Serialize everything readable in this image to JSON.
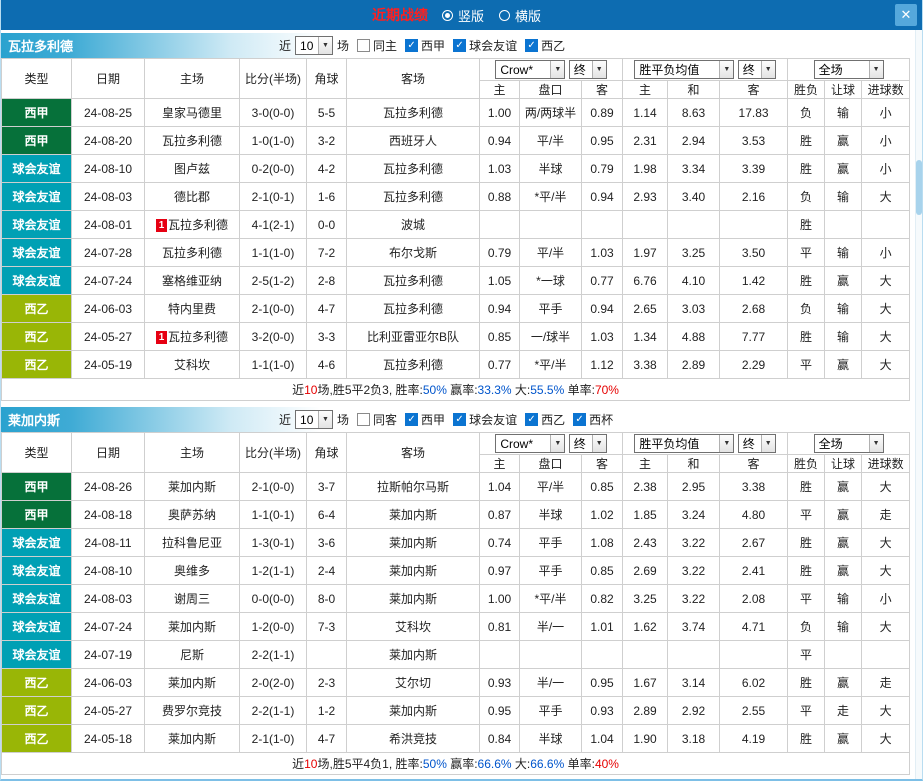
{
  "top_bar": {
    "title": "近期战绩",
    "portrait_label": "竖版",
    "landscape_label": "横版",
    "close_label": "✕"
  },
  "labels": {
    "near": "近",
    "games": "场"
  },
  "controls": {
    "odds_source": "Crow*",
    "final": "终",
    "europe_avg": "胜平负均值",
    "scope": "全场"
  },
  "columns": {
    "left": [
      "类型",
      "日期",
      "主场",
      "比分(半场)",
      "角球",
      "客场"
    ],
    "sub": [
      "主",
      "盘口",
      "客",
      "主",
      "和",
      "客",
      "胜负",
      "让球",
      "进球数"
    ]
  },
  "type_colors": {
    "西甲": "#06713a",
    "球会友谊": "#00a0b4",
    "西乙": "#99b606"
  },
  "sections": [
    {
      "team": "瓦拉多利德",
      "count": "10",
      "checkboxes": [
        {
          "label": "同主",
          "checked": false
        },
        {
          "label": "西甲",
          "checked": true
        },
        {
          "label": "球会友谊",
          "checked": true
        },
        {
          "label": "西乙",
          "checked": true
        }
      ],
      "rows": [
        {
          "type": "西甲",
          "date": "24-08-25",
          "home": "皇家马德里",
          "home_team": false,
          "home_badge": false,
          "score": "3-0(0-0)",
          "corners": "5-5",
          "away": "瓦拉多利德",
          "away_team": true,
          "ah_home": "1.00",
          "handicap": "两/两球半",
          "handicap_red": false,
          "ah_away": "0.89",
          "eu_home": "1.14",
          "eu_draw": "8.63",
          "eu_away": "17.83",
          "result": "负",
          "result_c": "r",
          "cover": "输",
          "cover_c": "g",
          "goals": "小",
          "goals_c": "g"
        },
        {
          "type": "西甲",
          "date": "24-08-20",
          "home": "瓦拉多利德",
          "home_team": true,
          "home_badge": false,
          "score": "1-0(1-0)",
          "corners": "3-2",
          "away": "西班牙人",
          "away_team": false,
          "ah_home": "0.94",
          "handicap": "平/半",
          "handicap_red": false,
          "ah_away": "0.95",
          "eu_home": "2.31",
          "eu_draw": "2.94",
          "eu_away": "3.53",
          "result": "胜",
          "result_c": "r",
          "cover": "赢",
          "cover_c": "r",
          "goals": "小",
          "goals_c": "g"
        },
        {
          "type": "球会友谊",
          "date": "24-08-10",
          "home": "图卢兹",
          "home_team": false,
          "home_badge": false,
          "score": "0-2(0-0)",
          "corners": "4-2",
          "away": "瓦拉多利德",
          "away_team": true,
          "ah_home": "1.03",
          "handicap": "半球",
          "handicap_red": false,
          "ah_away": "0.79",
          "eu_home": "1.98",
          "eu_draw": "3.34",
          "eu_away": "3.39",
          "result": "胜",
          "result_c": "r",
          "cover": "赢",
          "cover_c": "r",
          "goals": "小",
          "goals_c": "g"
        },
        {
          "type": "球会友谊",
          "date": "24-08-03",
          "home": "德比郡",
          "home_team": false,
          "home_badge": false,
          "score": "2-1(0-1)",
          "corners": "1-6",
          "away": "瓦拉多利德",
          "away_team": true,
          "ah_home": "0.88",
          "handicap": "*平/半",
          "handicap_red": true,
          "ah_away": "0.94",
          "eu_home": "2.93",
          "eu_draw": "3.40",
          "eu_away": "2.16",
          "result": "负",
          "result_c": "r",
          "cover": "输",
          "cover_c": "g",
          "goals": "大",
          "goals_c": "r"
        },
        {
          "type": "球会友谊",
          "date": "24-08-01",
          "home": "瓦拉多利德",
          "home_team": true,
          "home_badge": true,
          "score": "4-1(2-1)",
          "corners": "0-0",
          "away": "波城",
          "away_team": false,
          "ah_home": "",
          "handicap": "",
          "handicap_red": false,
          "ah_away": "",
          "eu_home": "",
          "eu_draw": "",
          "eu_away": "",
          "result": "胜",
          "result_c": "r",
          "cover": "",
          "cover_c": "k",
          "goals": "",
          "goals_c": "k"
        },
        {
          "type": "球会友谊",
          "date": "24-07-28",
          "home": "瓦拉多利德",
          "home_team": true,
          "home_badge": false,
          "score": "1-1(1-0)",
          "corners": "7-2",
          "away": "布尔戈斯",
          "away_team": false,
          "ah_home": "0.79",
          "handicap": "平/半",
          "handicap_red": false,
          "ah_away": "1.03",
          "eu_home": "1.97",
          "eu_draw": "3.25",
          "eu_away": "3.50",
          "result": "平",
          "result_c": "k",
          "cover": "输",
          "cover_c": "g",
          "goals": "小",
          "goals_c": "g"
        },
        {
          "type": "球会友谊",
          "date": "24-07-24",
          "home": "塞格维亚纳",
          "home_team": false,
          "home_badge": false,
          "score": "2-5(1-2)",
          "corners": "2-8",
          "away": "瓦拉多利德",
          "away_team": true,
          "ah_home": "1.05",
          "handicap": "*一球",
          "handicap_red": true,
          "ah_away": "0.77",
          "eu_home": "6.76",
          "eu_draw": "4.10",
          "eu_away": "1.42",
          "result": "胜",
          "result_c": "r",
          "cover": "赢",
          "cover_c": "r",
          "goals": "大",
          "goals_c": "r"
        },
        {
          "type": "西乙",
          "date": "24-06-03",
          "home": "特内里费",
          "home_team": false,
          "home_badge": false,
          "score": "2-1(0-0)",
          "corners": "4-7",
          "away": "瓦拉多利德",
          "away_team": true,
          "ah_home": "0.94",
          "handicap": "平手",
          "handicap_red": false,
          "ah_away": "0.94",
          "eu_home": "2.65",
          "eu_draw": "3.03",
          "eu_away": "2.68",
          "result": "负",
          "result_c": "r",
          "cover": "输",
          "cover_c": "g",
          "goals": "大",
          "goals_c": "r"
        },
        {
          "type": "西乙",
          "date": "24-05-27",
          "home": "瓦拉多利德",
          "home_team": true,
          "home_badge": true,
          "score": "3-2(0-0)",
          "corners": "3-3",
          "away": "比利亚雷亚尔B队",
          "away_team": false,
          "ah_home": "0.85",
          "handicap": "一/球半",
          "handicap_red": true,
          "ah_away": "1.03",
          "eu_home": "1.34",
          "eu_draw": "4.88",
          "eu_away": "7.77",
          "result": "胜",
          "result_c": "r",
          "cover": "输",
          "cover_c": "g",
          "goals": "大",
          "goals_c": "r"
        },
        {
          "type": "西乙",
          "date": "24-05-19",
          "home": "艾科坎",
          "home_team": false,
          "home_badge": false,
          "score": "1-1(1-0)",
          "corners": "4-6",
          "away": "瓦拉多利德",
          "away_team": true,
          "ah_home": "0.77",
          "handicap": "*平/半",
          "handicap_red": true,
          "ah_away": "1.12",
          "eu_home": "3.38",
          "eu_draw": "2.89",
          "eu_away": "2.29",
          "result": "平",
          "result_c": "k",
          "cover": "赢",
          "cover_c": "r",
          "goals": "大",
          "goals_c": "r"
        }
      ],
      "summary": [
        [
          "近",
          "k"
        ],
        [
          "10",
          "r"
        ],
        [
          "场,胜5平2负3, 胜率:",
          "k"
        ],
        [
          "50%",
          "b"
        ],
        [
          " 赢率:",
          "k"
        ],
        [
          "33.3%",
          "b"
        ],
        [
          " 大:",
          "k"
        ],
        [
          "55.5%",
          "b"
        ],
        [
          " 单率:",
          "k"
        ],
        [
          "70%",
          "r"
        ]
      ]
    },
    {
      "team": "莱加内斯",
      "count": "10",
      "checkboxes": [
        {
          "label": "同客",
          "checked": false
        },
        {
          "label": "西甲",
          "checked": true
        },
        {
          "label": "球会友谊",
          "checked": true
        },
        {
          "label": "西乙",
          "checked": true
        },
        {
          "label": "西杯",
          "checked": true
        }
      ],
      "rows": [
        {
          "type": "西甲",
          "date": "24-08-26",
          "home": "莱加内斯",
          "home_team": true,
          "home_badge": false,
          "score": "2-1(0-0)",
          "corners": "3-7",
          "away": "拉斯帕尔马斯",
          "away_team": false,
          "ah_home": "1.04",
          "handicap": "平/半",
          "handicap_red": false,
          "ah_away": "0.85",
          "eu_home": "2.38",
          "eu_draw": "2.95",
          "eu_away": "3.38",
          "result": "胜",
          "result_c": "r",
          "cover": "赢",
          "cover_c": "r",
          "goals": "大",
          "goals_c": "r"
        },
        {
          "type": "西甲",
          "date": "24-08-18",
          "home": "奥萨苏纳",
          "home_team": false,
          "home_badge": false,
          "score": "1-1(0-1)",
          "corners": "6-4",
          "away": "莱加内斯",
          "away_team": true,
          "ah_home": "0.87",
          "handicap": "半球",
          "handicap_red": false,
          "ah_away": "1.02",
          "eu_home": "1.85",
          "eu_draw": "3.24",
          "eu_away": "4.80",
          "result": "平",
          "result_c": "k",
          "cover": "赢",
          "cover_c": "r",
          "goals": "走",
          "goals_c": "r"
        },
        {
          "type": "球会友谊",
          "date": "24-08-11",
          "home": "拉科鲁尼亚",
          "home_team": false,
          "home_badge": false,
          "score": "1-3(0-1)",
          "corners": "3-6",
          "away": "莱加内斯",
          "away_team": true,
          "ah_home": "0.74",
          "handicap": "平手",
          "handicap_red": false,
          "ah_away": "1.08",
          "eu_home": "2.43",
          "eu_draw": "3.22",
          "eu_away": "2.67",
          "result": "胜",
          "result_c": "r",
          "cover": "赢",
          "cover_c": "r",
          "goals": "大",
          "goals_c": "r"
        },
        {
          "type": "球会友谊",
          "date": "24-08-10",
          "home": "奥维多",
          "home_team": false,
          "home_badge": false,
          "score": "1-2(1-1)",
          "corners": "2-4",
          "away": "莱加内斯",
          "away_team": true,
          "ah_home": "0.97",
          "handicap": "平手",
          "handicap_red": false,
          "ah_away": "0.85",
          "eu_home": "2.69",
          "eu_draw": "3.22",
          "eu_away": "2.41",
          "result": "胜",
          "result_c": "r",
          "cover": "赢",
          "cover_c": "r",
          "goals": "大",
          "goals_c": "r"
        },
        {
          "type": "球会友谊",
          "date": "24-08-03",
          "home": "谢周三",
          "home_team": false,
          "home_badge": false,
          "score": "0-0(0-0)",
          "corners": "8-0",
          "away": "莱加内斯",
          "away_team": true,
          "ah_home": "1.00",
          "handicap": "*平/半",
          "handicap_red": true,
          "ah_away": "0.82",
          "eu_home": "3.25",
          "eu_draw": "3.22",
          "eu_away": "2.08",
          "result": "平",
          "result_c": "k",
          "cover": "输",
          "cover_c": "g",
          "goals": "小",
          "goals_c": "g"
        },
        {
          "type": "球会友谊",
          "date": "24-07-24",
          "home": "莱加内斯",
          "home_team": true,
          "home_badge": false,
          "score": "1-2(0-0)",
          "corners": "7-3",
          "away": "艾科坎",
          "away_team": false,
          "ah_home": "0.81",
          "handicap": "半/一",
          "handicap_red": false,
          "ah_away": "1.01",
          "eu_home": "1.62",
          "eu_draw": "3.74",
          "eu_away": "4.71",
          "result": "负",
          "result_c": "r",
          "cover": "输",
          "cover_c": "g",
          "goals": "大",
          "goals_c": "r"
        },
        {
          "type": "球会友谊",
          "date": "24-07-19",
          "home": "尼斯",
          "home_team": false,
          "home_badge": false,
          "score": "2-2(1-1)",
          "corners": "",
          "away": "莱加内斯",
          "away_team": true,
          "ah_home": "",
          "handicap": "",
          "handicap_red": false,
          "ah_away": "",
          "eu_home": "",
          "eu_draw": "",
          "eu_away": "",
          "result": "平",
          "result_c": "k",
          "cover": "",
          "cover_c": "k",
          "goals": "",
          "goals_c": "k"
        },
        {
          "type": "西乙",
          "date": "24-06-03",
          "home": "莱加内斯",
          "home_team": true,
          "home_badge": false,
          "score": "2-0(2-0)",
          "corners": "2-3",
          "away": "艾尔切",
          "away_team": false,
          "ah_home": "0.93",
          "handicap": "半/一",
          "handicap_red": false,
          "ah_away": "0.95",
          "eu_home": "1.67",
          "eu_draw": "3.14",
          "eu_away": "6.02",
          "result": "胜",
          "result_c": "r",
          "cover": "赢",
          "cover_c": "r",
          "goals": "走",
          "goals_c": "r"
        },
        {
          "type": "西乙",
          "date": "24-05-27",
          "home": "费罗尔竞技",
          "home_team": false,
          "home_badge": false,
          "score": "2-2(1-1)",
          "corners": "1-2",
          "away": "莱加内斯",
          "away_team": true,
          "ah_home": "0.95",
          "handicap": "平手",
          "handicap_red": false,
          "ah_away": "0.93",
          "eu_home": "2.89",
          "eu_draw": "2.92",
          "eu_away": "2.55",
          "result": "平",
          "result_c": "k",
          "cover": "走",
          "cover_c": "r",
          "goals": "大",
          "goals_c": "r"
        },
        {
          "type": "西乙",
          "date": "24-05-18",
          "home": "莱加内斯",
          "home_team": true,
          "home_badge": false,
          "score": "2-1(1-0)",
          "corners": "4-7",
          "away": "希洪竞技",
          "away_team": false,
          "ah_home": "0.84",
          "handicap": "半球",
          "handicap_red": false,
          "ah_away": "1.04",
          "eu_home": "1.90",
          "eu_draw": "3.18",
          "eu_away": "4.19",
          "result": "胜",
          "result_c": "r",
          "cover": "赢",
          "cover_c": "r",
          "goals": "大",
          "goals_c": "r"
        }
      ],
      "summary": [
        [
          "近",
          "k"
        ],
        [
          "10",
          "r"
        ],
        [
          "场,胜5平4负1, 胜率:",
          "k"
        ],
        [
          "50%",
          "b"
        ],
        [
          " 赢率:",
          "k"
        ],
        [
          "66.6%",
          "b"
        ],
        [
          " 大:",
          "k"
        ],
        [
          "66.6%",
          "b"
        ],
        [
          " 单率:",
          "k"
        ],
        [
          "40%",
          "r"
        ]
      ]
    }
  ]
}
